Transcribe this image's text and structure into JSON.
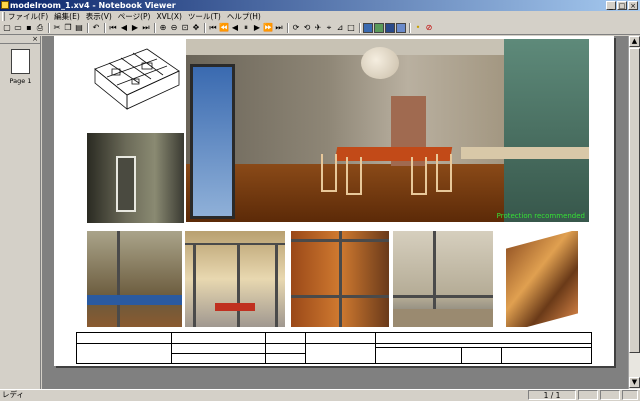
{
  "window": {
    "title": "modelroom_1.xv4 - Notebook Viewer"
  },
  "menu": {
    "items": [
      "ファイル(F)",
      "編集(E)",
      "表示(V)",
      "ページ(P)",
      "XVL(X)",
      "ツール(T)",
      "ヘルプ(H)"
    ]
  },
  "toolbar": {
    "icons": [
      "new-icon",
      "open-icon",
      "save-icon",
      "print-icon",
      "cut-icon",
      "copy-icon",
      "paste-icon",
      "undo-icon",
      "first-page-icon",
      "prev-page-icon",
      "next-page-icon",
      "last-page-icon",
      "zoom-in-icon",
      "zoom-out-icon",
      "fit-icon",
      "pan-icon",
      "play-first-icon",
      "play-rewind-icon",
      "play-back-icon",
      "pause-icon",
      "play-icon",
      "play-forward-icon",
      "play-last-icon",
      "rotate-icon",
      "walk-icon",
      "fly-icon",
      "select-icon",
      "measure-icon",
      "section-icon",
      "color-1-icon",
      "color-2-icon",
      "color-3-icon",
      "color-4-icon",
      "light-icon",
      "stop-icon"
    ]
  },
  "thumbnails": {
    "page_label": "Page 1"
  },
  "page": {
    "watermark": "Protection recommended"
  },
  "status": {
    "ready": "レディ",
    "page_indicator": "1 / 1"
  },
  "colors": {
    "titlebar_start": "#0a246a",
    "titlebar_end": "#a6caf0",
    "workspace_bg": "#808080",
    "watermark_text": "#35e035"
  }
}
